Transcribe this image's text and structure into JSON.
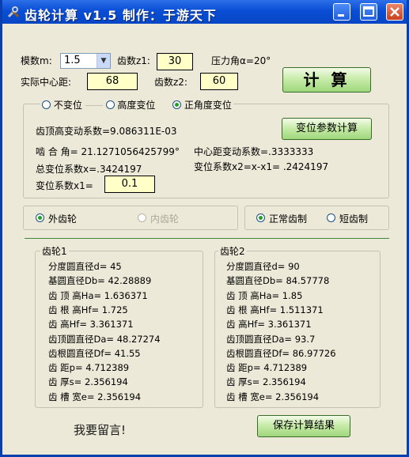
{
  "window": {
    "title": "齿轮计算 v1.5 制作：于游天下"
  },
  "inputs": {
    "modulus_label": "模数m:",
    "modulus_value": "1.5",
    "z1_label": "齿数z1:",
    "z1_value": "30",
    "pressure_angle_label": "压力角α=20°",
    "center_distance_label": "实际中心距:",
    "center_distance_value": "68",
    "z2_label": "齿数z2:",
    "z2_value": "60",
    "calculate_label": "计  算"
  },
  "shift_type": {
    "options": [
      "不变位",
      "高度变位",
      "正角度变位"
    ],
    "selected": 2
  },
  "shift_params": {
    "tip_coef": "齿顶高变动系数=9.086311E-03",
    "mesh_angle": "啮 合 角= 21.1271056425799°",
    "center_coef": "中心距变动系数=.3333333",
    "total_coef": "总变位系数x=.3424197",
    "x2_coef": "变位系数x2=x-x1= .2424197",
    "x1_label": "变位系数x1=",
    "x1_value": "0.1",
    "calc_button": "变位参数计算"
  },
  "gear_kind": {
    "external": "外齿轮",
    "internal": "内齿轮"
  },
  "tooth_system": {
    "normal": "正常齿制",
    "short": "短齿制"
  },
  "gear1": {
    "title": "齿轮1",
    "lines": [
      "分度圆直径d= 45",
      "基圆直径Db= 42.28889",
      "齿 顶 高Ha= 1.636371",
      "齿 根 高Hf= 1.725",
      "齿    高Hf= 3.361371",
      "齿顶圆直径Da= 48.27274",
      "齿根圆直径Df= 41.55",
      "齿    距p= 4.712389",
      "齿    厚s= 2.356194",
      "齿 槽 宽e= 2.356194"
    ]
  },
  "gear2": {
    "title": "齿轮2",
    "lines": [
      "分度圆直径d= 90",
      "基圆直径Db= 84.57778",
      "齿 顶 高Ha= 1.85",
      "齿 根 高Hf= 1.511371",
      "齿    高Hf= 3.361371",
      "齿顶圆直径Da= 93.7",
      "齿根圆直径Df= 86.97726",
      "齿    距p= 4.712389",
      "齿    厚s= 2.356194",
      "齿 槽 宽e= 2.356194"
    ]
  },
  "footer": {
    "comment": "我要留言!",
    "save_button": "保存计算结果"
  }
}
